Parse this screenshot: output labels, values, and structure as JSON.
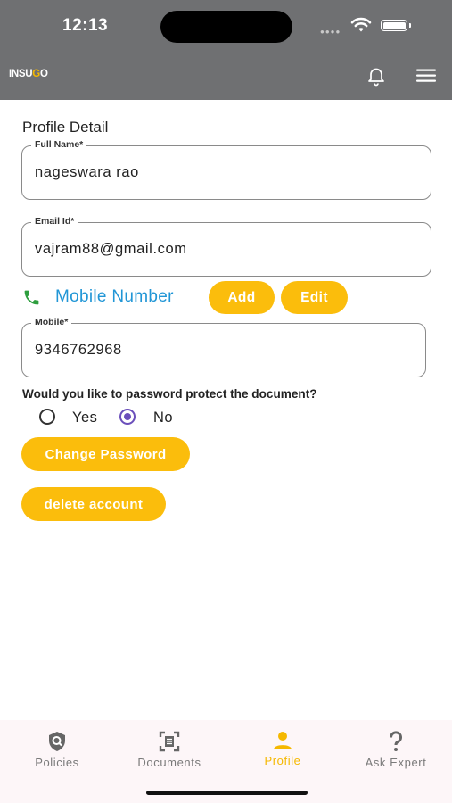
{
  "status_bar": {
    "time": "12:13"
  },
  "header": {
    "logo_text_a": "INSU",
    "logo_text_b": "G",
    "logo_text_c": "O",
    "accent_color": "#fbbd0c",
    "bell_icon": "bell-icon",
    "menu_icon": "hamburger-menu-icon"
  },
  "profile": {
    "title": "Profile Detail",
    "full_name": {
      "label": "Full Name*",
      "value": "nageswara rao"
    },
    "email": {
      "label": "Email Id*",
      "value": "vajram88@gmail.com"
    },
    "mobile_section": {
      "title": "Mobile Number",
      "add_label": "Add",
      "edit_label": "Edit",
      "icon": "phone-icon"
    },
    "mobile": {
      "label": "Mobile*",
      "value": "9346762968"
    },
    "password_question": "Would you like to password protect the document?",
    "options": {
      "yes": "Yes",
      "no": "No",
      "selected": "No"
    },
    "change_password_label": "Change Password",
    "delete_account_label": "delete account"
  },
  "bottom_nav": {
    "items": [
      {
        "label": "Policies",
        "icon": "shield-search-icon",
        "active": false
      },
      {
        "label": "Documents",
        "icon": "document-scan-icon",
        "active": false
      },
      {
        "label": "Profile",
        "icon": "person-icon",
        "active": true
      },
      {
        "label": "Ask Expert",
        "icon": "question-icon",
        "active": false
      }
    ]
  }
}
